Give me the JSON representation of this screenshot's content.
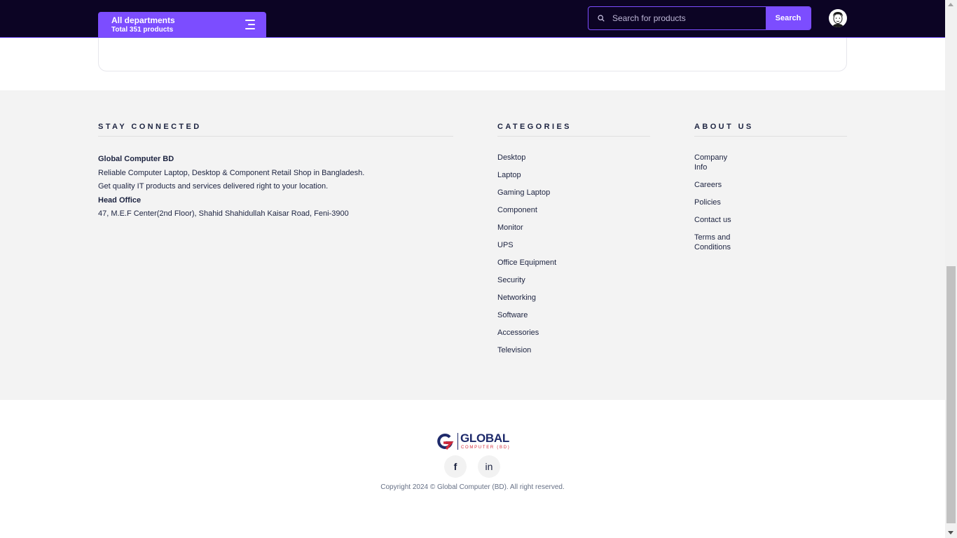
{
  "header": {
    "departments_title": "All departments",
    "departments_sub": "Total 351 products",
    "search_placeholder": "Search for products",
    "search_button": "Search"
  },
  "footer": {
    "stay_connected": {
      "heading": "STAY CONNECTED",
      "company": "Global Computer BD",
      "line1": "Reliable Computer Laptop, Desktop & Component Retail Shop in Bangladesh.",
      "line2": "Get quality IT products and services delivered right to your location.",
      "office_heading": "Head Office",
      "address": "47, M.E.F Center(2nd Floor), Shahid Shahidullah Kaisar Road, Feni-3900"
    },
    "categories": {
      "heading": "CATEGORIES",
      "items": [
        "Desktop",
        "Laptop",
        "Gaming Laptop",
        "Component",
        "Monitor",
        "UPS",
        "Office Equipment",
        "Security",
        "Networking",
        "Software",
        "Accessories",
        "Television"
      ]
    },
    "about": {
      "heading": "ABOUT US",
      "items": [
        "Company Info",
        "Careers",
        "Policies",
        "Contact us",
        "Terms and Conditions"
      ]
    }
  },
  "bottom": {
    "logo_text": "GLOBAL",
    "logo_sub": "COMPUTER (BD)",
    "facebook_glyph": "f",
    "linkedin_glyph": "in",
    "copyright": "Copyright 2024 © Global Computer (BD). All right reserved."
  },
  "colors": {
    "header_bg": "#0c0424",
    "accent": "#7c4dff",
    "footer_bg": "#f3f3f3",
    "text": "#1c2340",
    "logo_red": "#d32a3a",
    "logo_blue": "#1e2a6b"
  }
}
